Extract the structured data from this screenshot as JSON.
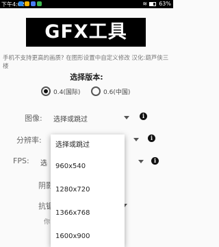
{
  "status_bar": {
    "time": "下午4:02",
    "battery": "63%",
    "app_icon_colors": [
      "#2d8cf0",
      "#f5b400",
      "#4a7cf6",
      "#3fb950"
    ]
  },
  "header": {
    "title": "GFX工具"
  },
  "notice": "手机不支持更高的画质? 在图形设置中自定义修改 汉化:葫芦侠三楼",
  "version": {
    "title": "选择版本:",
    "options": [
      {
        "label": "0.4(国际)",
        "selected": true
      },
      {
        "label": "0.6(中国)",
        "selected": false
      }
    ]
  },
  "settings": {
    "graphics": {
      "label": "图像:",
      "value": "选择或跳过"
    },
    "resolution": {
      "label": "分辨率:"
    },
    "fps": {
      "label": "FPS:",
      "value": "选"
    },
    "shadow": {
      "label": "阴影"
    },
    "antialias": {
      "label": "抗锯",
      "hint": "你"
    }
  },
  "resolution_menu": {
    "options": [
      "选择或跳过",
      "960x540",
      "1280x720",
      "1366x768",
      "1600x900"
    ]
  },
  "icons": {
    "info": "info-icon",
    "dropdown": "chevron-down-icon"
  }
}
